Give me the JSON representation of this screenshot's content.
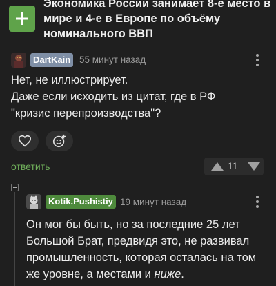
{
  "post": {
    "title": "Экономика России занимает 8-е место в мире и 4-е в Европе по объёму номинального ВВП"
  },
  "comments": [
    {
      "username": "DartKain",
      "time": "55 минут назад",
      "lines": [
        "Нет, не иллюстрирует.",
        "Даже если исходить из цитат, где в РФ",
        "\"кризис перепроизводства\"?"
      ],
      "reply_label": "ответить",
      "rating": "11",
      "username_color": "#7f8fa6"
    },
    {
      "username": "Kotik.Pushistiy",
      "time": "19 минут назад",
      "lines": [
        "Он мог бы быть, но за последние 25 лет",
        "Большой Брат, предвидя это, не развивал",
        "промышленность, которая осталась на том"
      ],
      "last_line_prefix": "же уровне, а местами и ",
      "last_line_italic": "ниже",
      "last_line_suffix": ".",
      "username_color": "#4e8a3c"
    }
  ],
  "icons": {
    "add": "plus-icon",
    "like": "heart-icon",
    "emoji": "smiley-plus-icon",
    "more": "more-vertical-icon",
    "up": "arrow-up-icon",
    "down": "arrow-down-icon"
  },
  "colors": {
    "background": "#1f1f1f",
    "accent_green": "#5fa34a",
    "reply_green": "#6fae5a"
  }
}
